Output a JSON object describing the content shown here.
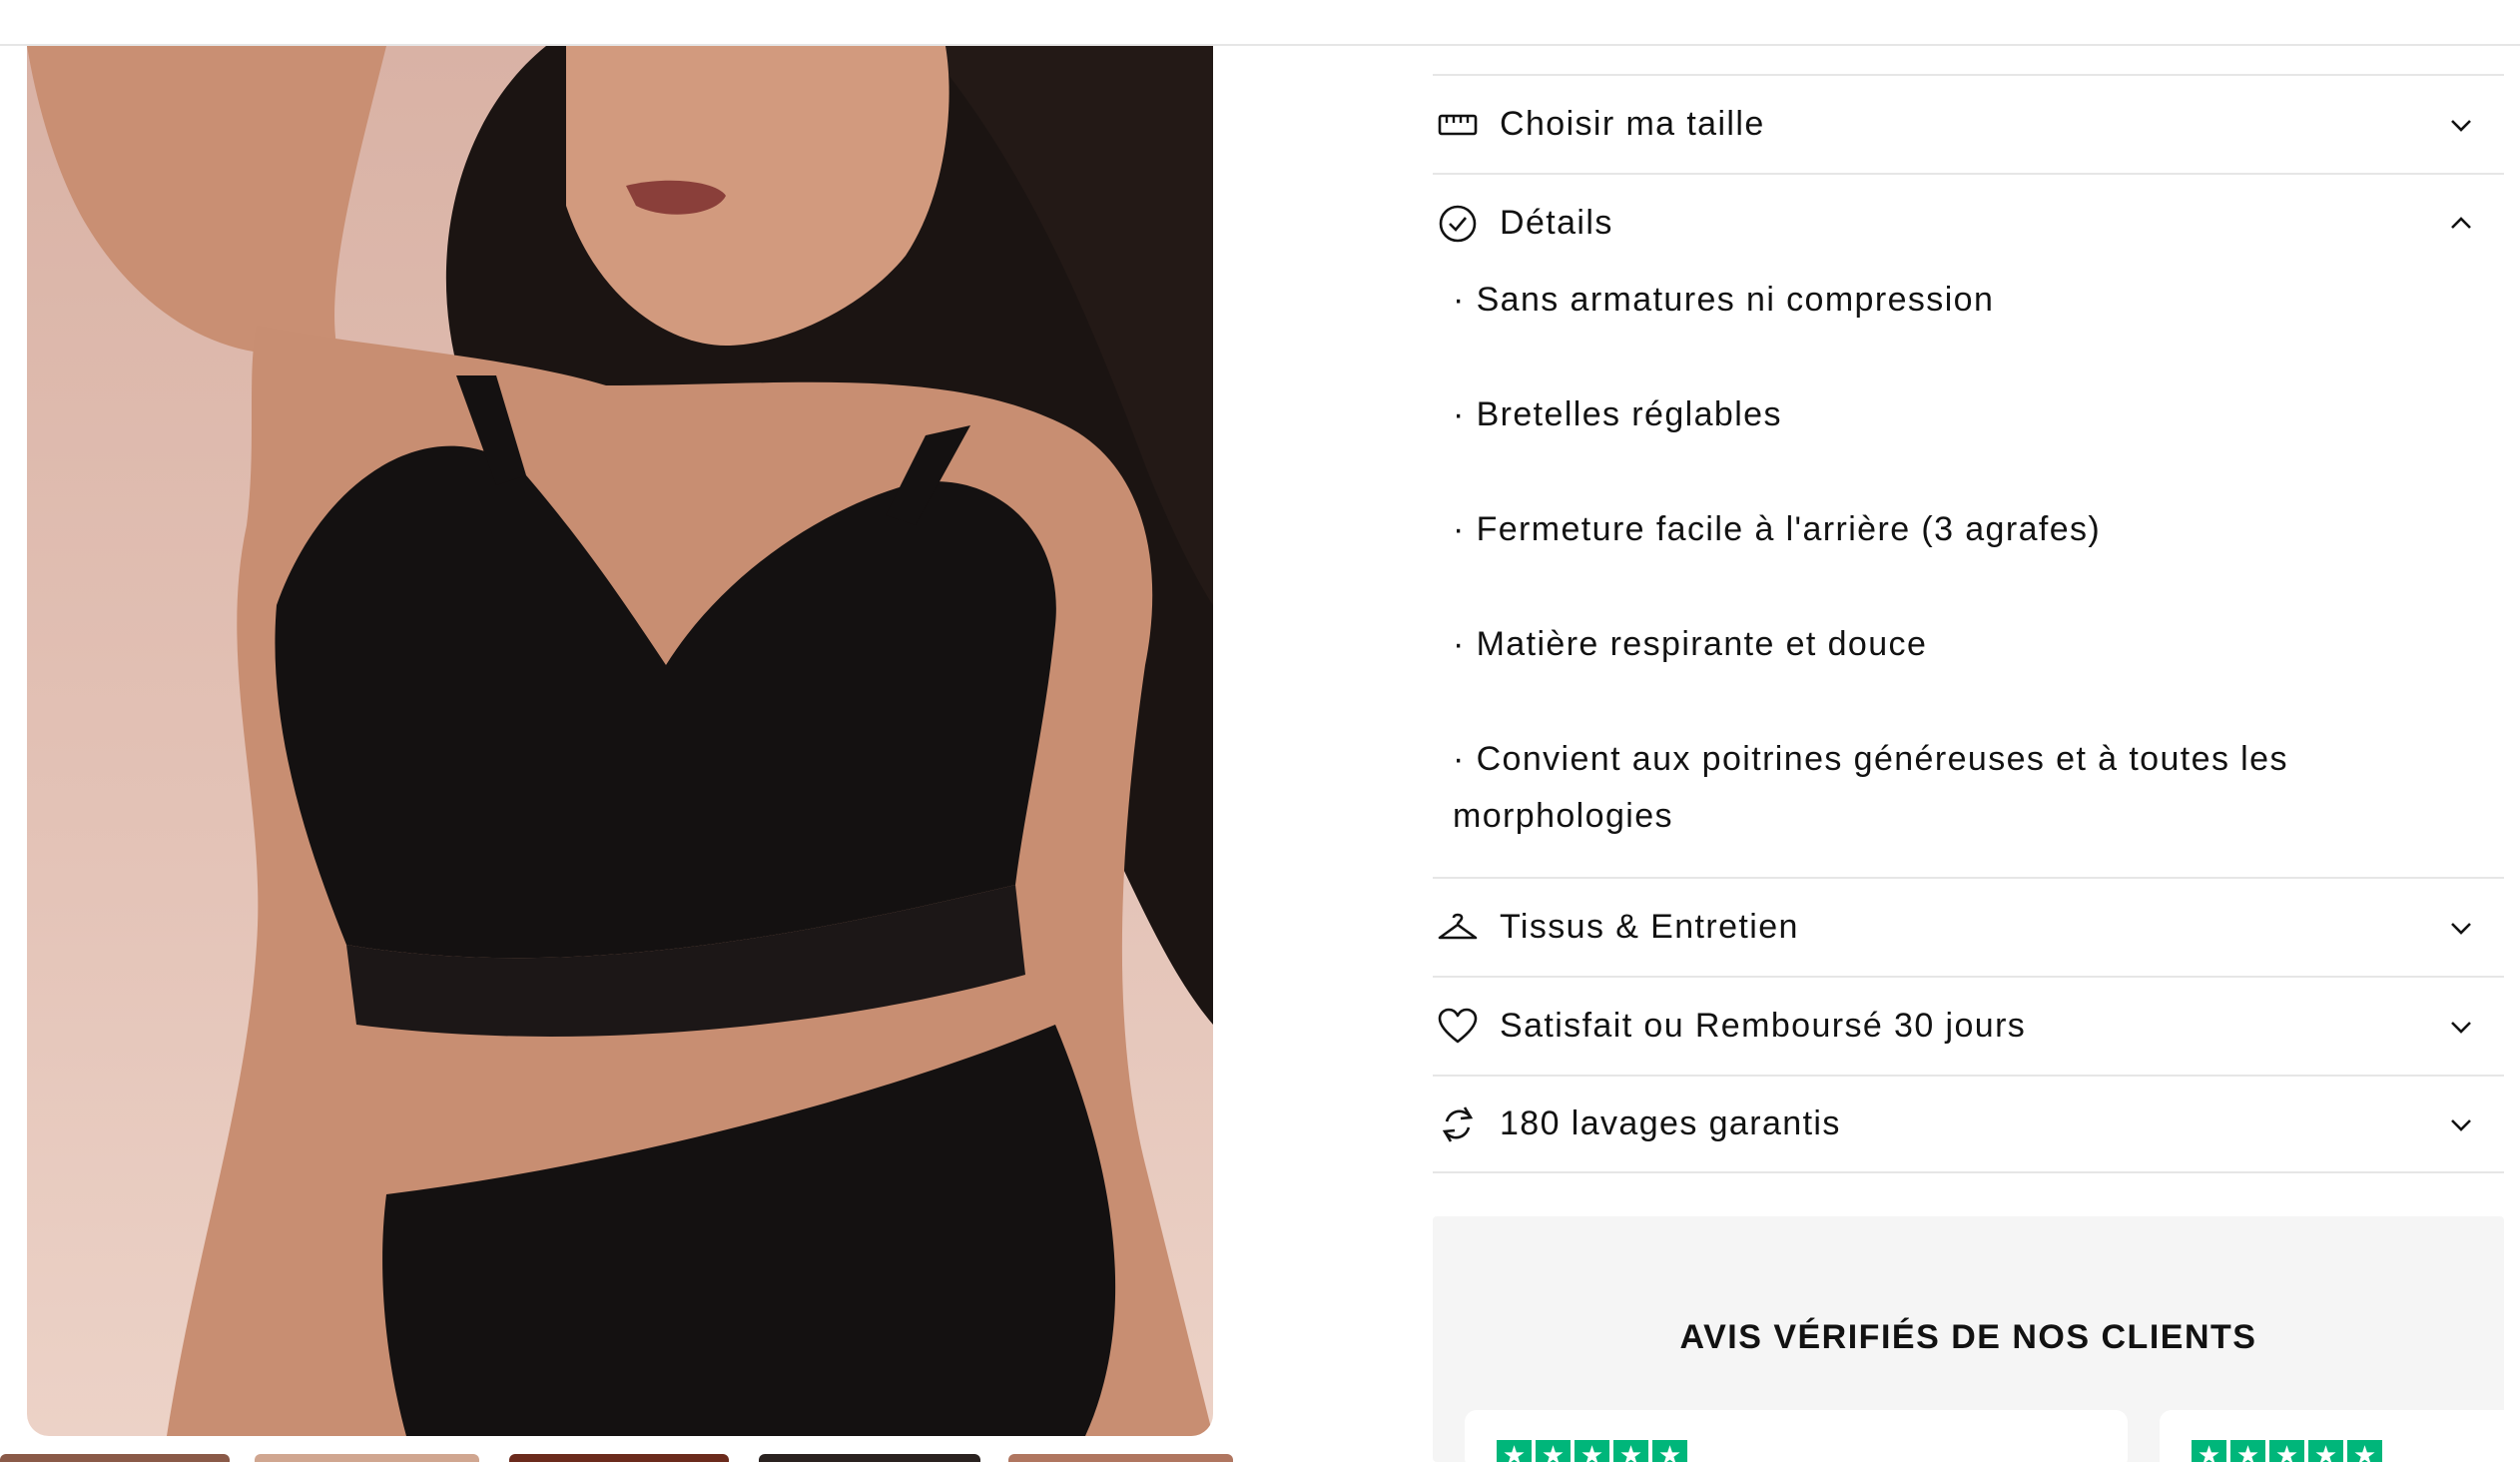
{
  "accordion": {
    "size": {
      "label": "Choisir ma taille",
      "icon": "ruler-icon",
      "state": "collapsed"
    },
    "details": {
      "label": "Détails",
      "icon": "check-circle-icon",
      "state": "expanded",
      "bullets": [
        "· Sans armatures ni compression",
        "· Bretelles réglables",
        "· Fermeture facile à l'arrière (3 agrafes)",
        "· Matière respirante et douce",
        "· Convient aux poitrines généreuses et à toutes les morphologies"
      ]
    },
    "fabric": {
      "label": "Tissus & Entretien",
      "icon": "hanger-icon",
      "state": "collapsed"
    },
    "refund": {
      "label": "Satisfait ou Remboursé 30 jours",
      "icon": "heart-icon",
      "state": "collapsed"
    },
    "washes": {
      "label": "180 lavages garantis",
      "icon": "refresh-icon",
      "state": "collapsed"
    }
  },
  "reviews": {
    "title": "AVIS VÉRIFIÉS DE NOS CLIENTS",
    "star_color": "#00b67a",
    "cards": [
      {
        "rating": 5
      },
      {
        "rating": 5
      }
    ]
  },
  "colors": {
    "background_panel": "#f5f5f5",
    "divider": "#e6e6e6",
    "text": "#121212",
    "product_backdrop": "#d9b2a5"
  }
}
